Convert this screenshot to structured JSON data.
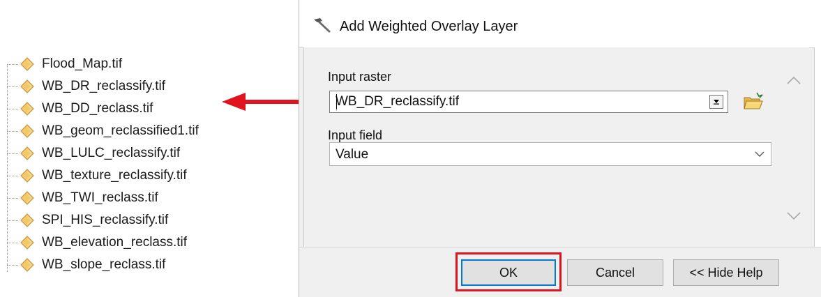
{
  "layer_tree": {
    "items": [
      {
        "label": "Flood_Map.tif",
        "icon": "raster-layer-icon"
      },
      {
        "label": "WB_DR_reclassify.tif",
        "icon": "raster-layer-icon"
      },
      {
        "label": "WB_DD_reclass.tif",
        "icon": "raster-layer-icon"
      },
      {
        "label": "WB_geom_reclassified1.tif",
        "icon": "raster-layer-icon"
      },
      {
        "label": "WB_LULC_reclassify.tif",
        "icon": "raster-layer-icon"
      },
      {
        "label": "WB_texture_reclassify.tif",
        "icon": "raster-layer-icon"
      },
      {
        "label": "WB_TWI_reclass.tif",
        "icon": "raster-layer-icon"
      },
      {
        "label": "SPI_HIS_reclassify.tif",
        "icon": "raster-layer-icon"
      },
      {
        "label": "WB_elevation_reclass.tif",
        "icon": "raster-layer-icon"
      },
      {
        "label": "WB_slope_reclass.tif",
        "icon": "raster-layer-icon"
      }
    ],
    "icon_color": "#f5c86a"
  },
  "annotation": {
    "arrow_icon": "left-arrow-icon",
    "color": "#e0141e"
  },
  "dialog": {
    "title": "Add Weighted Overlay Layer",
    "title_icon": "hammer-icon",
    "input_raster": {
      "label": "Input raster",
      "value": "WB_DR_reclassify.tif"
    },
    "browse_icon": "open-folder-icon",
    "input_field": {
      "label": "Input field",
      "value": "Value"
    },
    "buttons": {
      "ok": "OK",
      "cancel": "Cancel",
      "hide_help": "<< Hide Help"
    },
    "focus_color": "#0078d7",
    "highlight_color": "#e0141e"
  }
}
